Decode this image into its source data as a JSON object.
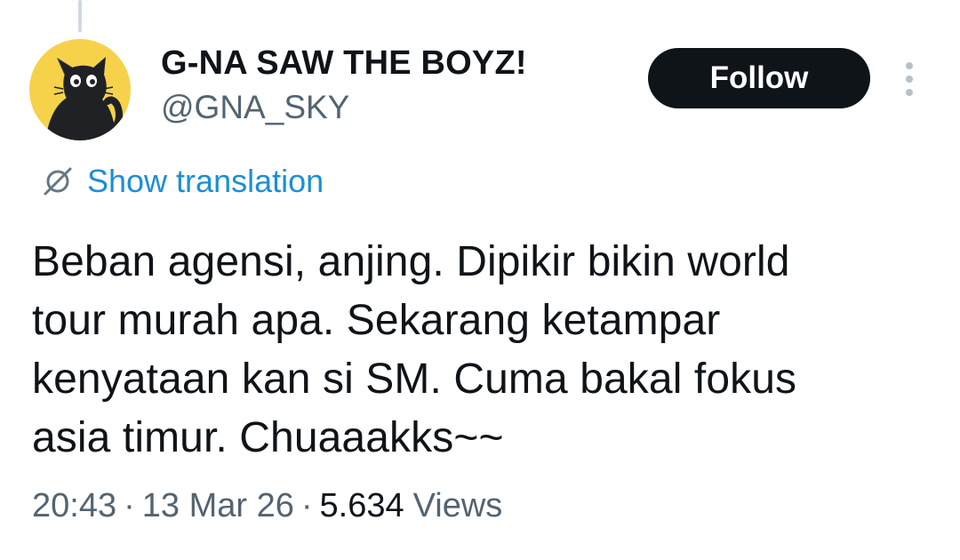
{
  "author": {
    "display_name": "G-NA SAW THE BOYZ!",
    "handle": "@GNA_SKY",
    "avatar_icon": "black-cat-on-yellow"
  },
  "actions": {
    "follow_label": "Follow",
    "more_icon": "vertical-ellipsis-icon"
  },
  "translation": {
    "icon": "globe-slash-icon",
    "label": "Show translation"
  },
  "tweet": {
    "lines": [
      "Beban agensi, anjing. Dipikir bikin world",
      "tour murah apa. Sekarang ketampar",
      "kenyataan kan si SM. Cuma bakal fokus",
      "asia timur. Chuaaakks~~"
    ]
  },
  "meta": {
    "time": "20:43",
    "separator": "·",
    "date": "13 Mar 26",
    "views_count": "5.634",
    "views_label": "Views"
  },
  "colors": {
    "follow_bg": "#0f1419",
    "link": "#1b8fd6",
    "secondary_text": "#536471",
    "primary_text": "#0f1419"
  }
}
